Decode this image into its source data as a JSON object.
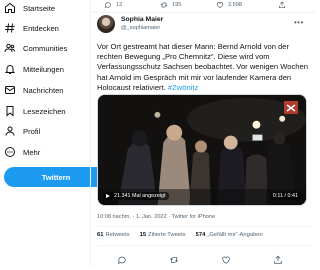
{
  "sidebar": {
    "items": [
      {
        "label": "Startseite",
        "icon": "home-icon"
      },
      {
        "label": "Entdecken",
        "icon": "hashtag-icon"
      },
      {
        "label": "Communities",
        "icon": "communities-icon"
      },
      {
        "label": "Mitteilungen",
        "icon": "bell-icon"
      },
      {
        "label": "Nachrichten",
        "icon": "mail-icon"
      },
      {
        "label": "Lesezeichen",
        "icon": "bookmark-icon"
      },
      {
        "label": "Profil",
        "icon": "profile-icon"
      },
      {
        "label": "Mehr",
        "icon": "more-circle-icon"
      }
    ],
    "tweet_button": "Twittern"
  },
  "top_actions": {
    "replies": "12",
    "retweets": "195",
    "likes": "3.598"
  },
  "tweet": {
    "author_name": "Sophia Maier",
    "author_handle": "@_sophiamaier",
    "text": "Vor Ort gestreamt hat dieser Mann: Bernd Arnold von der rechten Bewegung „Pro Chemnitz“. Diese wird vom Verfassungsschutz Sachsen beobachtet. Vor wenigen Wochen hat Arnold im Gespräch mit mir vor laufender Kamera den Holocaust relativiert.",
    "hashtag": "#Zwönitz",
    "video": {
      "views": "21.341 Mal angezeigt",
      "time": "0:11 / 0:41"
    },
    "meta": "10:08 nachm. · 1. Jan. 2022 · Twitter for iPhone",
    "stats": {
      "retweets_count": "61",
      "retweets_label": "Retweets",
      "quotes_count": "15",
      "quotes_label": "Zitierte Tweets",
      "likes_count": "574",
      "likes_label": "„Gefällt mir“-Angaben"
    }
  },
  "colors": {
    "accent": "#1d9bf0",
    "text": "#0f1419",
    "muted": "#536471"
  }
}
